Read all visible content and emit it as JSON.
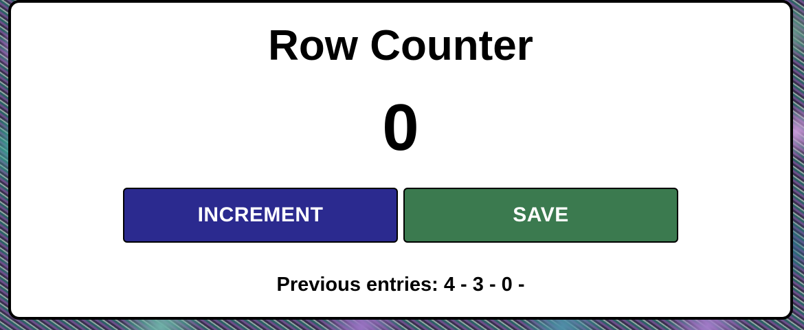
{
  "counter": {
    "title": "Row Counter",
    "value": "0",
    "increment_label": "INCREMENT",
    "save_label": "SAVE",
    "previous_entries_text": "Previous entries: 4 - 3 - 0 -",
    "previous_entries": [
      4,
      3,
      0
    ]
  },
  "colors": {
    "increment_button": "#2b2a8f",
    "save_button": "#3b7a4f",
    "card_background": "#ffffff",
    "card_border": "#000000"
  }
}
